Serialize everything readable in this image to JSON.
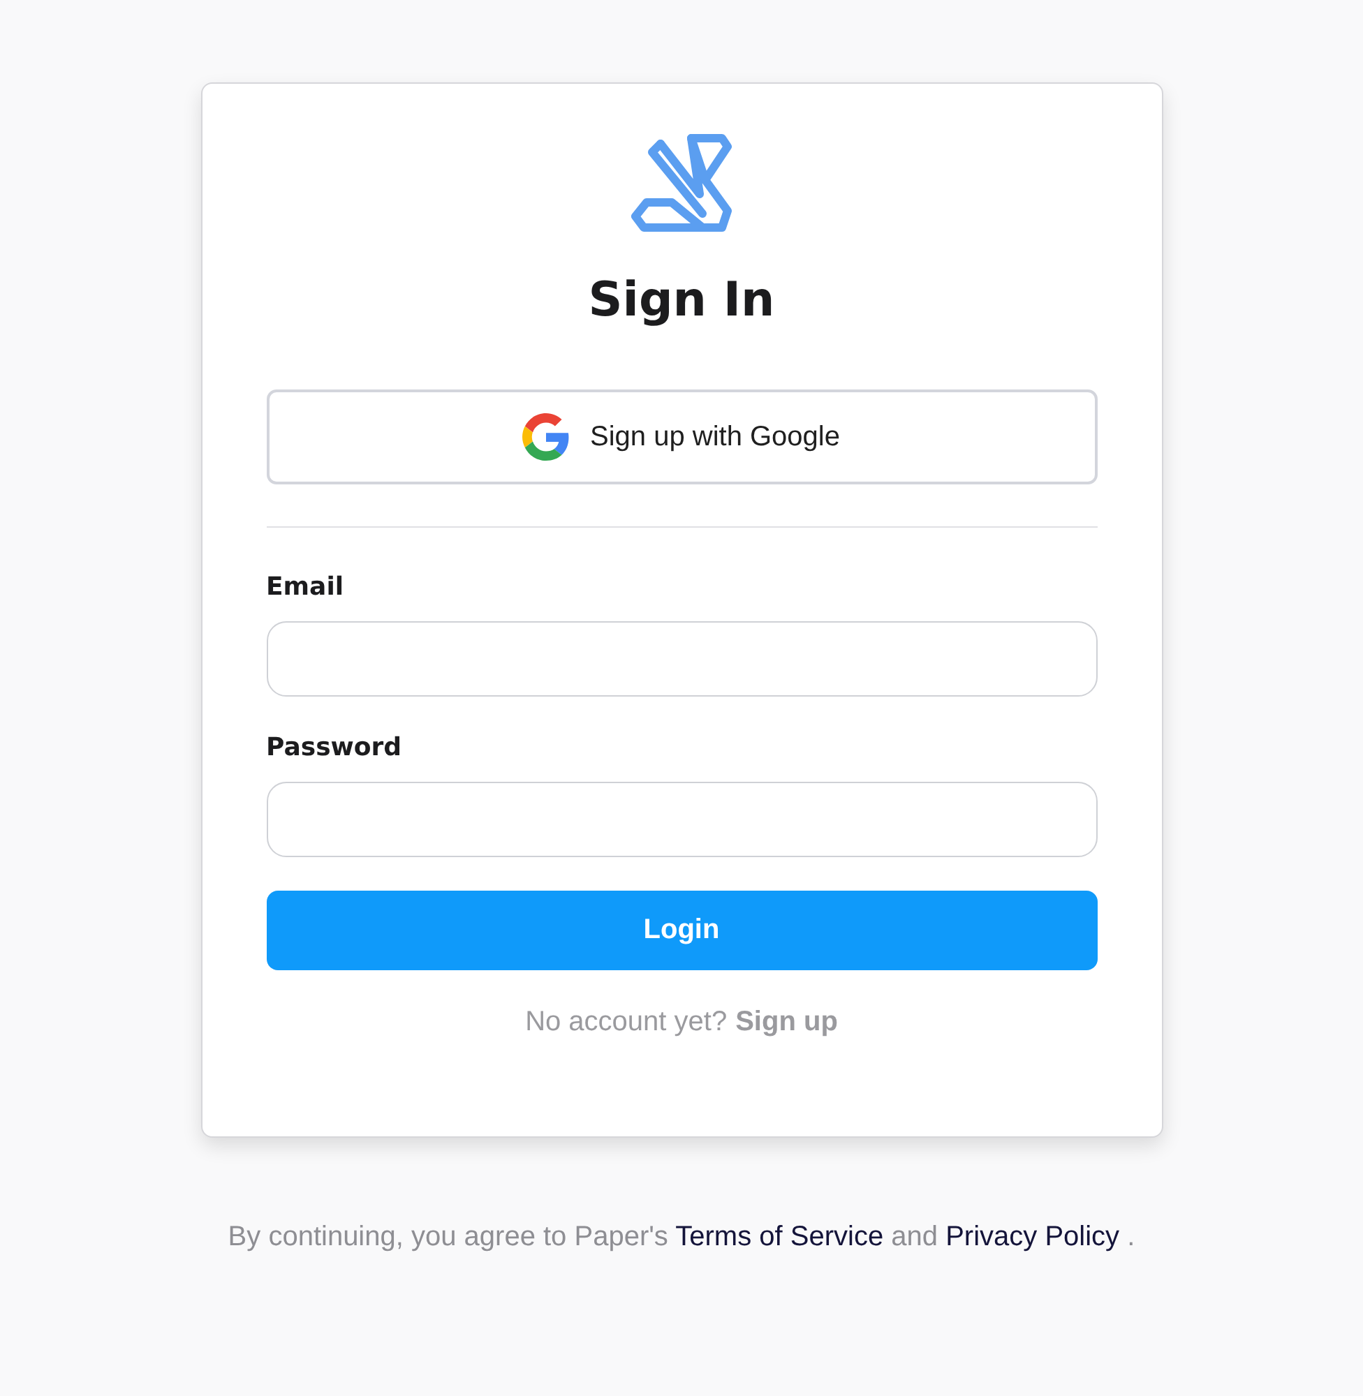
{
  "title": "Sign In",
  "google_button": {
    "label": "Sign up with Google"
  },
  "fields": [
    {
      "label": "Email"
    },
    {
      "label": "Password"
    }
  ],
  "login_button": {
    "label": "Login"
  },
  "signup_prompt": {
    "text": "No account yet?",
    "link": "Sign up"
  },
  "footer": [
    {
      "kind": "text",
      "text": "By continuing, you agree to Paper's"
    },
    {
      "kind": "link",
      "text": "Terms of Service"
    },
    {
      "kind": "text",
      "text": "and"
    },
    {
      "kind": "link",
      "text": "Privacy Policy"
    },
    {
      "kind": "text",
      "text": "."
    }
  ]
}
